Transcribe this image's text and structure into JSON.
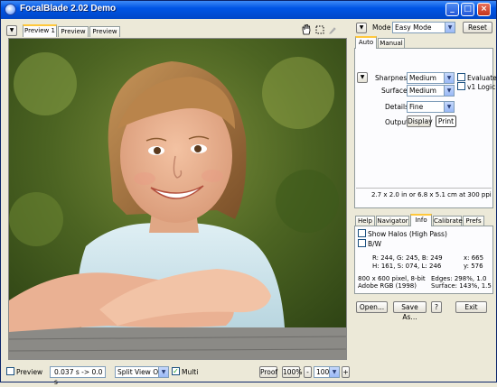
{
  "window": {
    "title": "FocalBlade 2.02 Demo"
  },
  "preview_tabs": [
    "Preview 1",
    "Preview 2",
    "Preview 3"
  ],
  "mode": {
    "label": "Mode",
    "value": "Easy Mode",
    "reset": "Reset"
  },
  "main_tabs": [
    "Auto",
    "Manual"
  ],
  "auto": {
    "sharpness_label": "Sharpness",
    "sharpness_value": "Medium",
    "surface_label": "Surface",
    "surface_value": "Medium",
    "details_label": "Details",
    "details_value": "Fine",
    "output_label": "Output",
    "display_btn": "Display",
    "print_btn": "Print",
    "evaluate_label": "Evaluate",
    "v1logic_label": "v1 Logic",
    "size_info": "2.7 x 2.0 in  or  6.8 x 5.1 cm  at 300 ppi"
  },
  "info_tabs": [
    "Help",
    "Navigator",
    "Info",
    "Calibrate",
    "Prefs"
  ],
  "info": {
    "show_halos": "Show Halos (High Pass)",
    "bw": "B/W",
    "rgb": "R: 244, G: 245, B: 249",
    "hsl": "H: 161, S: 074, L: 246",
    "x": "x: 665",
    "y": "y: 576",
    "pixels": "800 x 600 pixel, 8-bit",
    "profile": "Adobe RGB (1998)",
    "edges": "Edges:   298%, 1.0",
    "surface": "Surface:  143%, 1.5"
  },
  "buttons": {
    "open": "Open...",
    "save_as": "Save As...",
    "help": "?",
    "exit": "Exit"
  },
  "bottom": {
    "preview_label": "Preview",
    "timing": "0.037 s -> 0.0 s",
    "view": "Split View Off",
    "multi_label": "Multi",
    "proof": "Proof",
    "zoom1": "100%",
    "minus": "-",
    "zoom2": "100%",
    "plus": "+"
  },
  "icons": [
    "hand-icon",
    "marquee-icon",
    "eyedropper-icon",
    "menu-arrow-icon"
  ]
}
